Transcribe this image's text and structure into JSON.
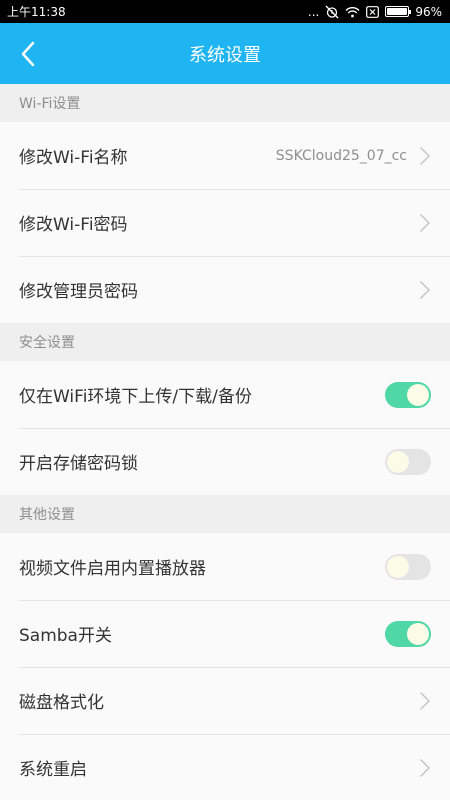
{
  "status_bar": {
    "time": "上午11:38",
    "dots": "...",
    "battery_percent": "96%",
    "battery_level": 0.96
  },
  "app_bar": {
    "title": "系统设置"
  },
  "sections": [
    {
      "header": "Wi-Fi设置",
      "rows": [
        {
          "label": "修改Wi-Fi名称",
          "value": "SSKCloud25_07_cc"
        },
        {
          "label": "修改Wi-Fi密码"
        },
        {
          "label": "修改管理员密码"
        }
      ]
    },
    {
      "header": "安全设置",
      "rows": [
        {
          "label": "仅在WiFi环境下上传/下载/备份",
          "toggle": true
        },
        {
          "label": "开启存储密码锁",
          "toggle": false
        }
      ]
    },
    {
      "header": "其他设置",
      "rows": [
        {
          "label": "视频文件启用内置播放器",
          "toggle": false
        },
        {
          "label": "Samba开关",
          "toggle": true
        },
        {
          "label": "磁盘格式化"
        },
        {
          "label": "系统重启"
        }
      ]
    }
  ],
  "colors": {
    "app_bar": "#1fb4f2",
    "toggle_on": "#4fd7a6",
    "toggle_off": "#e4e4e4"
  }
}
